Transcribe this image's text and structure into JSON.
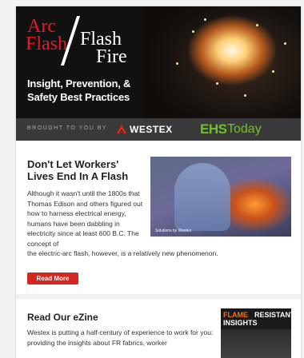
{
  "hero": {
    "line1": "Arc",
    "line2": "Flash",
    "line3": "Flash",
    "line4": "Fire",
    "tagline": "Insight, Prevention, & Safety Best Practices"
  },
  "sponsor": {
    "brought": "BROUGHT TO YOU BY",
    "westex": "WESTEX",
    "ehs": "EHS",
    "today": "Today"
  },
  "article": {
    "title": "Don't Let Workers' Lives End In A Flash",
    "body_narrow": "Although it wasn't until the 1800s that Thomas Edison and others figured out how to harness electrical energy, humans have been dabbling in electricity since at least 600 B.C. The concept of",
    "body_wide": "the electric-arc flash, however, is a relatively new phenomenon.",
    "image_caption": "Solutions by Westex",
    "read_more": "Read More"
  },
  "ezine": {
    "title": "Read Our eZine",
    "body": "Westex is putting a half-century of experience to work for you: providing the insights about FR fabrics, worker",
    "cover_word1": "FLAME",
    "cover_word2": "RESISTANT",
    "cover_word3": "INSIGHTS"
  },
  "colors": {
    "accent_red": "#d3261f",
    "ehs_green": "#6fc12a",
    "title_red": "#e21b23"
  }
}
